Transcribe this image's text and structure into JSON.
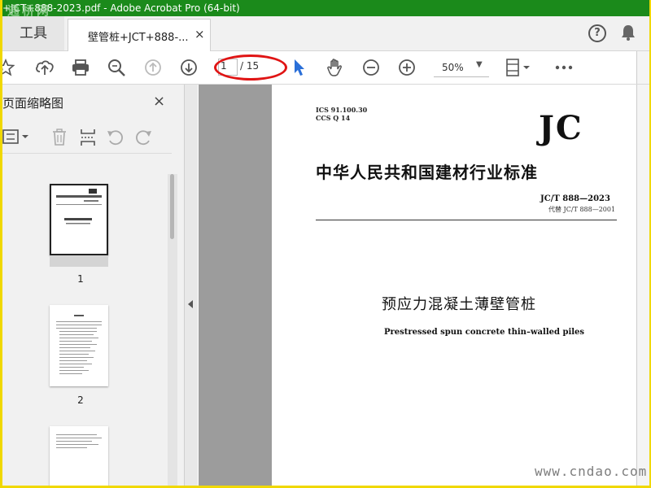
{
  "window": {
    "title": "+JCT+888-2023.pdf - Adobe Acrobat Pro (64-bit)",
    "watermark_top": "通桥网"
  },
  "tabs": {
    "tools_label": "工具",
    "doc_tab_label": "壁管桩+JCT+888-...",
    "close_glyph": "×"
  },
  "header_icons": {
    "help": "question-circle-icon",
    "notifications": "bell-icon",
    "help_glyph": "?"
  },
  "toolbar": {
    "current_page": "1",
    "page_separator_total": "/ 15",
    "zoom": "50%"
  },
  "sidebar": {
    "title": "页面缩略图",
    "close_glyph": "×",
    "thumbnails": [
      {
        "number": "1"
      },
      {
        "number": "2"
      }
    ]
  },
  "document": {
    "ics": "ICS 91.100.30",
    "ccs": "CCS Q 14",
    "category_mark": "JC",
    "standard_title": "中华人民共和国建材行业标准",
    "standard_code": "JC/T 888—2023",
    "replaces": "代替 JC/T 888—2001",
    "chinese_name": "预应力混凝土薄壁管桩",
    "english_name": "Prestressed spun concrete thin–walled piles"
  },
  "watermark_bottom": "www.cndao.com",
  "colors": {
    "title_bar": "#1b8a1b",
    "outer_border": "#f0d800",
    "annotation_circle": "#e01414",
    "select_tool_blue": "#2a6fd8"
  }
}
